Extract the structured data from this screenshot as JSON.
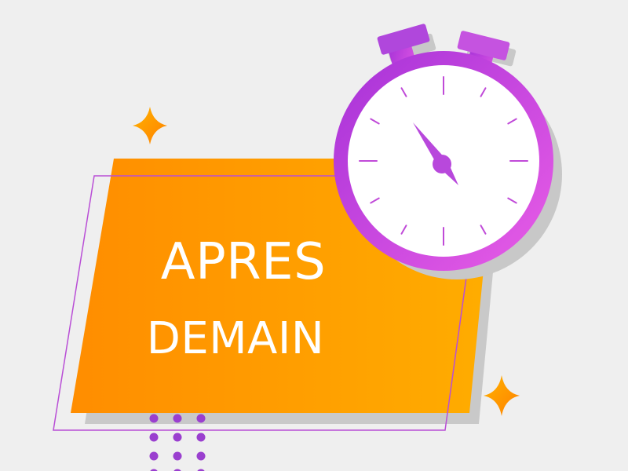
{
  "banner": {
    "line1": "APRES",
    "line2": "DEMAIN"
  },
  "icons": {
    "timer": "stopwatch-icon",
    "sparkle": "sparkle-icon",
    "dots": "dot-grid"
  },
  "colors": {
    "background": "#efefef",
    "banner_start": "#ff8f00",
    "banner_end": "#ffab00",
    "accent_purple": "#b53bdc",
    "accent_purple_light": "#e35ce6",
    "sparkle_orange": "#ff9a00",
    "dot_purple": "#9a3fcf",
    "text": "#ffffff"
  }
}
